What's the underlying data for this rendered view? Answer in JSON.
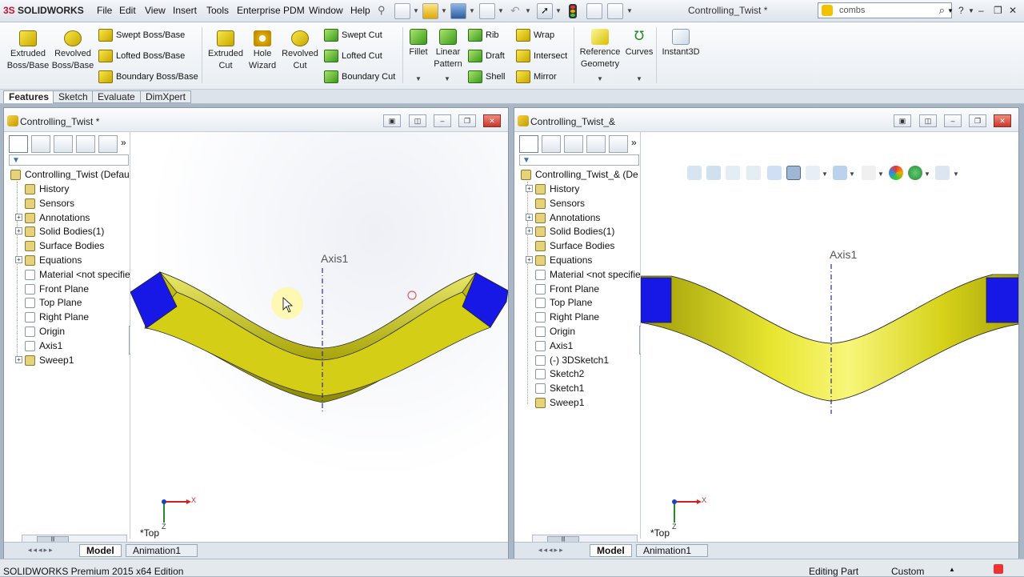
{
  "app": {
    "logo_ds": "3S",
    "logo_text": "SOLIDWORKS",
    "doc_title": "Controlling_Twist *"
  },
  "menu": [
    "File",
    "Edit",
    "View",
    "Insert",
    "Tools",
    "Enterprise PDM",
    "Window",
    "Help"
  ],
  "search": {
    "value": "combs"
  },
  "ribbon": {
    "extruded_boss": "Extruded\nBoss/Base",
    "revolved_boss": "Revolved\nBoss/Base",
    "swept_boss": "Swept Boss/Base",
    "lofted_boss": "Lofted Boss/Base",
    "boundary_boss": "Boundary Boss/Base",
    "extruded_cut": "Extruded\nCut",
    "hole_wizard": "Hole\nWizard",
    "revolved_cut": "Revolved\nCut",
    "swept_cut": "Swept Cut",
    "lofted_cut": "Lofted Cut",
    "boundary_cut": "Boundary Cut",
    "fillet": "Fillet",
    "linear_pattern": "Linear\nPattern",
    "rib": "Rib",
    "draft": "Draft",
    "shell": "Shell",
    "wrap": "Wrap",
    "intersect": "Intersect",
    "mirror": "Mirror",
    "reference_geometry": "Reference\nGeometry",
    "curves": "Curves",
    "instant3d": "Instant3D"
  },
  "tabs": [
    "Features",
    "Sketch",
    "Evaluate",
    "DimXpert"
  ],
  "left_pane": {
    "title": "Controlling_Twist *",
    "root": "Controlling_Twist  (Defau",
    "items": [
      {
        "label": "History",
        "icon": "history-icon",
        "expand": false
      },
      {
        "label": "Sensors",
        "icon": "sensors-icon",
        "expand": false
      },
      {
        "label": "Annotations",
        "icon": "annotations-icon",
        "expand": true
      },
      {
        "label": "Solid Bodies(1)",
        "icon": "solid-bodies-icon",
        "expand": true
      },
      {
        "label": "Surface Bodies",
        "icon": "surface-bodies-icon",
        "expand": false
      },
      {
        "label": "Equations",
        "icon": "equations-icon",
        "expand": true
      },
      {
        "label": "Material <not specifie",
        "icon": "material-icon",
        "expand": false
      },
      {
        "label": "Front  Plane",
        "icon": "plane-icon",
        "expand": false
      },
      {
        "label": "Top Plane",
        "icon": "plane-icon",
        "expand": false
      },
      {
        "label": "Right Plane",
        "icon": "plane-icon",
        "expand": false
      },
      {
        "label": "Origin",
        "icon": "origin-icon",
        "expand": false
      },
      {
        "label": "Axis1",
        "icon": "axis-icon",
        "expand": false
      },
      {
        "label": "Sweep1",
        "icon": "sweep-icon",
        "expand": true
      }
    ],
    "axis_label": "Axis1",
    "view_label": "*Top",
    "bottom_tabs": [
      "Model",
      "Animation1"
    ]
  },
  "right_pane": {
    "title": "Controlling_Twist_&",
    "root": "Controlling_Twist_&  (De",
    "items": [
      {
        "label": "History",
        "icon": "history-icon",
        "expand": true
      },
      {
        "label": "Sensors",
        "icon": "sensors-icon",
        "expand": false
      },
      {
        "label": "Annotations",
        "icon": "annotations-icon",
        "expand": true
      },
      {
        "label": "Solid Bodies(1)",
        "icon": "solid-bodies-icon",
        "expand": true
      },
      {
        "label": "Surface Bodies",
        "icon": "surface-bodies-icon",
        "expand": false
      },
      {
        "label": "Equations",
        "icon": "equations-icon",
        "expand": true
      },
      {
        "label": "Material <not specifie",
        "icon": "material-icon",
        "expand": false
      },
      {
        "label": "Front  Plane",
        "icon": "plane-icon",
        "expand": false
      },
      {
        "label": "Top Plane",
        "icon": "plane-icon",
        "expand": false
      },
      {
        "label": "Right Plane",
        "icon": "plane-icon",
        "expand": false
      },
      {
        "label": "Origin",
        "icon": "origin-icon",
        "expand": false
      },
      {
        "label": "Axis1",
        "icon": "axis-icon",
        "expand": false
      },
      {
        "label": "(-) 3DSketch1",
        "icon": "sketch3d-icon",
        "expand": false
      },
      {
        "label": "Sketch2",
        "icon": "sketch-icon",
        "expand": false
      },
      {
        "label": "Sketch1",
        "icon": "sketch-icon",
        "expand": false
      },
      {
        "label": "Sweep1",
        "icon": "sweep-icon",
        "expand": false
      }
    ],
    "axis_label": "Axis1",
    "view_label": "*Top",
    "bottom_tabs": [
      "Model",
      "Animation1"
    ]
  },
  "axes": {
    "x": "X",
    "y": "Y",
    "z": "Z"
  },
  "status": {
    "edition": "SOLIDWORKS Premium 2015 x64 Edition",
    "mode": "Editing Part",
    "units": "Custom"
  },
  "colors": {
    "part_yellow": "#d6d21a",
    "end_cap_blue": "#1a1de6",
    "axis_blue": "#2a2aa0"
  }
}
